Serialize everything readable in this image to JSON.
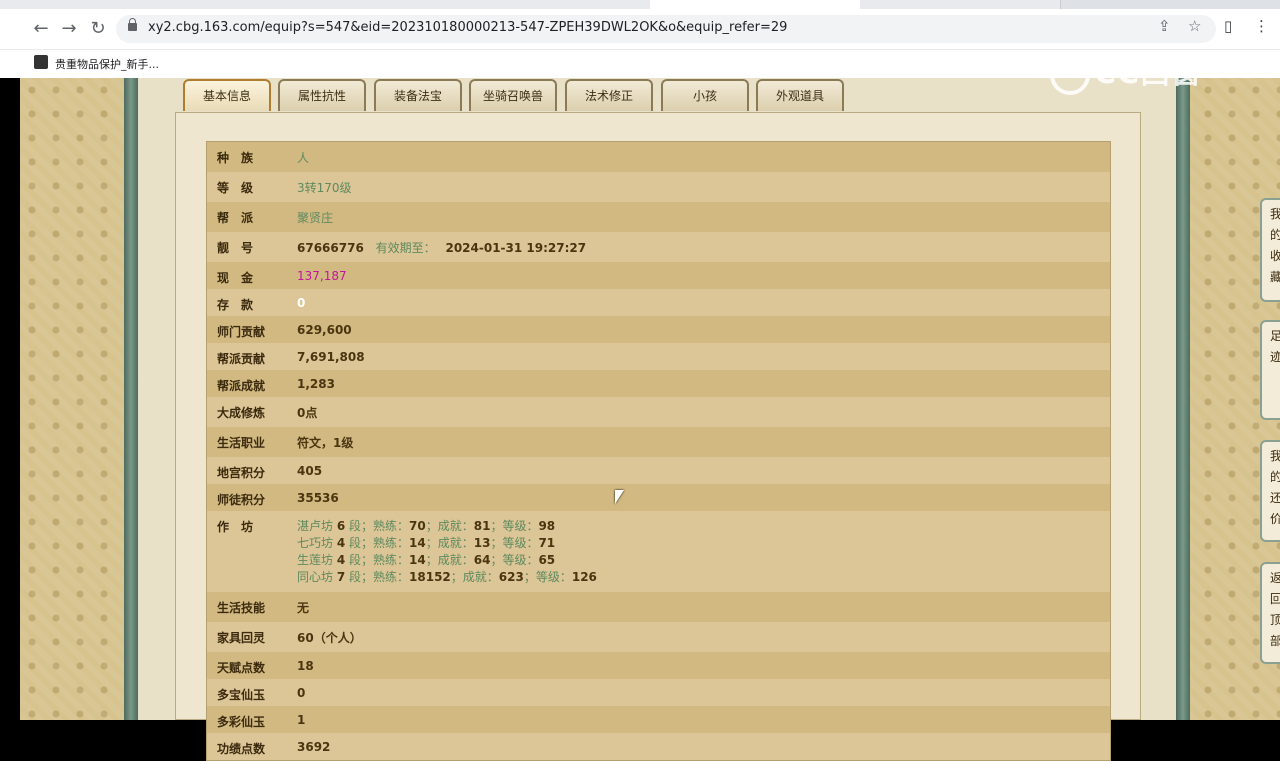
{
  "browser": {
    "url": "xy2.cbg.163.com/equip?s=547&eid=202310180000213-547-ZPEH39DWL2OK&o&equip_refer=29",
    "bookmark": "贵重物品保护_新手..."
  },
  "watermark": "CC西窗",
  "tabs": [
    "基本信息",
    "属性抗性",
    "装备法宝",
    "坐骑召唤兽",
    "法术修正",
    "小孩",
    "外观道具"
  ],
  "active_tab": "基本信息",
  "rows": [
    {
      "label": "种　族",
      "value": "人"
    },
    {
      "label": "等　级",
      "value": "3转170级"
    },
    {
      "label": "帮　派",
      "value": "聚贤庄"
    },
    {
      "label": "靓　号",
      "value": "67666776",
      "extra_label": "有效期至：",
      "extra_value": "2024-01-31 19:27:27"
    },
    {
      "label": "现　金",
      "value": "137,187"
    },
    {
      "label": "存　款",
      "value": "0"
    },
    {
      "label": "师门贡献",
      "value": "629,600"
    },
    {
      "label": "帮派贡献",
      "value": "7,691,808"
    },
    {
      "label": "帮派成就",
      "value": "1,283"
    },
    {
      "label": "大成修炼",
      "value": "0点"
    },
    {
      "label": "生活职业",
      "value": "符文，1级"
    },
    {
      "label": "地宫积分",
      "value": "405"
    },
    {
      "label": "师徒积分",
      "value": "35536"
    },
    {
      "label": "作　坊",
      "workshops": [
        {
          "name": "湛卢坊",
          "duan": "6",
          "shulian": "70",
          "chengjiu": "81",
          "dengji": "98"
        },
        {
          "name": "七巧坊",
          "duan": "4",
          "shulian": "14",
          "chengjiu": "13",
          "dengji": "71"
        },
        {
          "name": "生莲坊",
          "duan": "4",
          "shulian": "14",
          "chengjiu": "64",
          "dengji": "65"
        },
        {
          "name": "同心坊",
          "duan": "7",
          "shulian": "18152",
          "chengjiu": "623",
          "dengji": "126"
        }
      ]
    },
    {
      "label": "生活技能",
      "value": "无"
    },
    {
      "label": "家具回灵",
      "value": "60（个人）"
    },
    {
      "label": "天赋点数",
      "value": "18"
    },
    {
      "label": "多宝仙玉",
      "value": "0"
    },
    {
      "label": "多彩仙玉",
      "value": "1"
    },
    {
      "label": "功绩点数",
      "value": "3692"
    }
  ],
  "workshop_words": {
    "duan": "段；",
    "shulian": "熟练：",
    "chengjiu": "成就：",
    "dengji": "等级："
  },
  "side_buttons": [
    "我的收藏",
    "足迹",
    "我的还价",
    "返回顶部"
  ]
}
